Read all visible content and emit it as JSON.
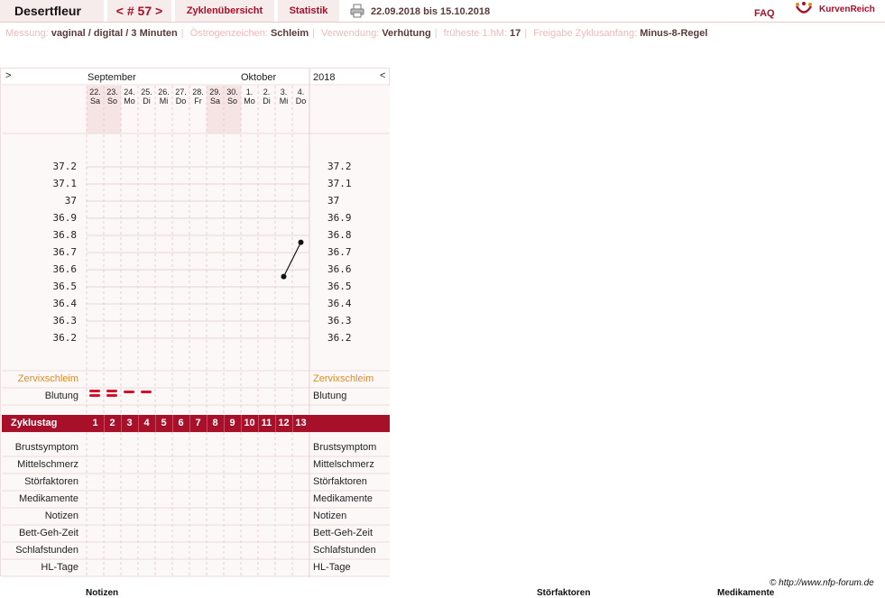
{
  "header": {
    "username": "Desertfleur",
    "cycle": "< # 57 >",
    "tab_overview": "Zyklenübersicht",
    "tab_stats": "Statistik",
    "date_range": "22.09.2018 bis 15.10.2018",
    "faq": "FAQ",
    "brand": "KurvenReich"
  },
  "meta": [
    {
      "key": "Messung:",
      "value": "vaginal / digital / 3 Minuten"
    },
    {
      "key": "Östrogenzeichen:",
      "value": "Schleim"
    },
    {
      "key": "Verwendung:",
      "value": "Verhütung"
    },
    {
      "key": "früheste 1.hM:",
      "value": "17"
    },
    {
      "key": "Freigabe Zyklusanfang:",
      "value": "Minus-8-Regel"
    }
  ],
  "chart": {
    "prev": ">",
    "next": "<",
    "month1": "September",
    "month2": "Oktober",
    "year": "2018",
    "days": [
      {
        "d": "22.",
        "w": "Sa"
      },
      {
        "d": "23.",
        "w": "So"
      },
      {
        "d": "24.",
        "w": "Mo"
      },
      {
        "d": "25.",
        "w": "Di"
      },
      {
        "d": "26.",
        "w": "Mi"
      },
      {
        "d": "27.",
        "w": "Do"
      },
      {
        "d": "28.",
        "w": "Fr"
      },
      {
        "d": "29.",
        "w": "Sa"
      },
      {
        "d": "30.",
        "w": "So"
      },
      {
        "d": "1.",
        "w": "Mo"
      },
      {
        "d": "2.",
        "w": "Di"
      },
      {
        "d": "3.",
        "w": "Mi"
      },
      {
        "d": "4.",
        "w": "Do"
      }
    ],
    "temps": [
      "37.2",
      "37.1",
      "37",
      "36.9",
      "36.8",
      "36.7",
      "36.6",
      "36.5",
      "36.4",
      "36.3",
      "36.2"
    ],
    "label_mucus": "Zervixschleim",
    "label_bleeding": "Blutung",
    "label_cycleday": "Zyklustag",
    "cycledays": [
      "1",
      "2",
      "3",
      "4",
      "5",
      "6",
      "7",
      "8",
      "9",
      "10",
      "11",
      "12",
      "13"
    ],
    "rows": [
      "Brustsymptom",
      "Mittelschmerz",
      "Störfaktoren",
      "Medikamente",
      "Notizen",
      "Bett-Geh-Zeit",
      "Schlafstunden",
      "HL-Tage"
    ]
  },
  "chart_data": {
    "type": "line",
    "x": [
      "3.",
      "4."
    ],
    "y": [
      36.56,
      36.76
    ],
    "ylim": [
      36.1,
      37.3
    ],
    "bleeding": [
      "22.",
      "23.",
      "24.",
      "25."
    ],
    "bleeding_strength": [
      "heavy",
      "heavy",
      "light",
      "light"
    ]
  },
  "footer": {
    "copyright": "© http://www.nfp-forum.de",
    "col1": "Notizen",
    "col2": "Störfaktoren",
    "col3": "Medikamente"
  },
  "colors": {
    "accent": "#a8102a",
    "bleed": "#d2122c",
    "mucus": "#e08a1f"
  }
}
